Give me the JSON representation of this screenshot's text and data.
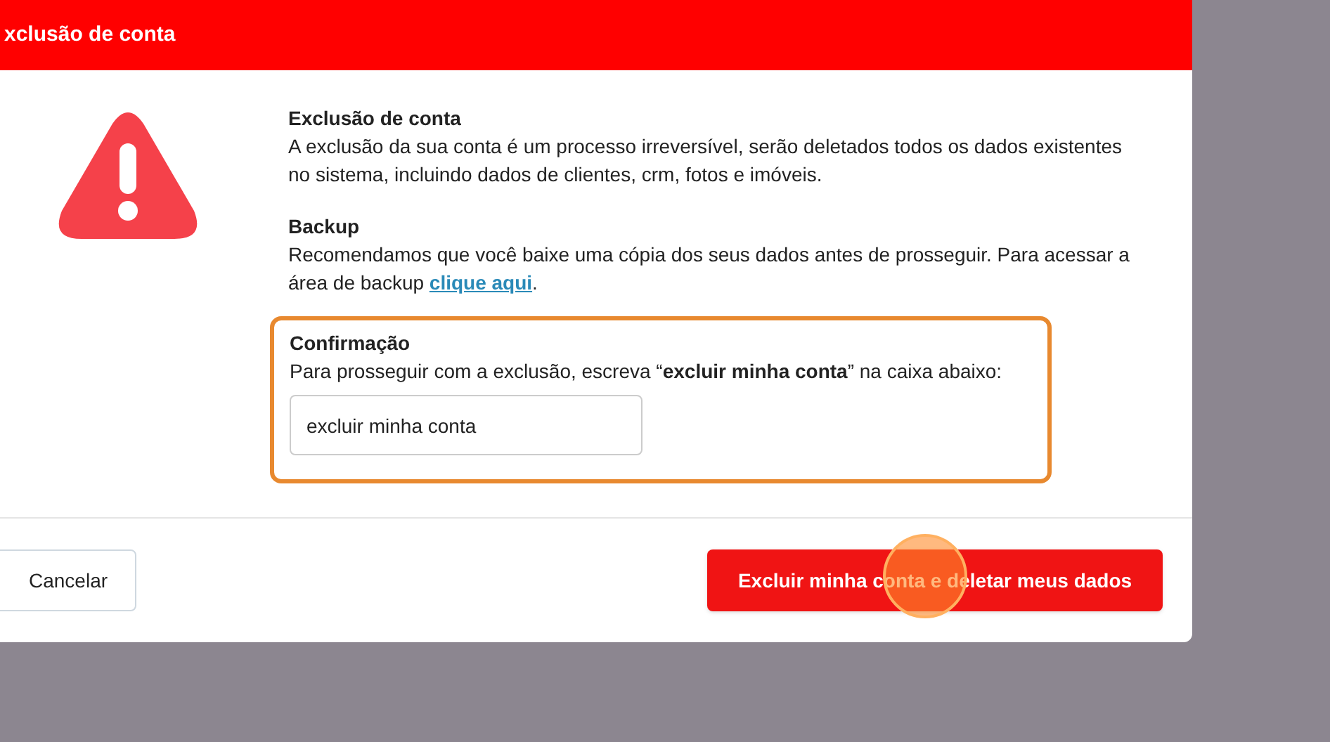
{
  "dialog": {
    "title": "xclusão de conta",
    "sections": [
      {
        "heading": "Exclusão de conta",
        "text": "A exclusão da sua conta é um processo irreversível, serão deletados todos os dados existentes no sistema, incluindo dados de clientes, crm, fotos e imóveis."
      },
      {
        "heading": "Backup",
        "text": "Recomendamos que você baixe uma cópia dos seus dados antes de prosseguir. Para acessar a área de backup ",
        "link": "clique aqui",
        "after": "."
      }
    ],
    "confirmation": {
      "heading": "Confirmação",
      "text": "Para prosseguir com a exclusão, escreva “**excluir minha conta**” na caixa abaixo:",
      "value": "excluir minha conta"
    },
    "buttons": [
      {
        "label": "Cancelar",
        "kind": "secondary"
      },
      {
        "label": "Excluir minha conta e deletar meus dados",
        "kind": "danger"
      }
    ]
  }
}
